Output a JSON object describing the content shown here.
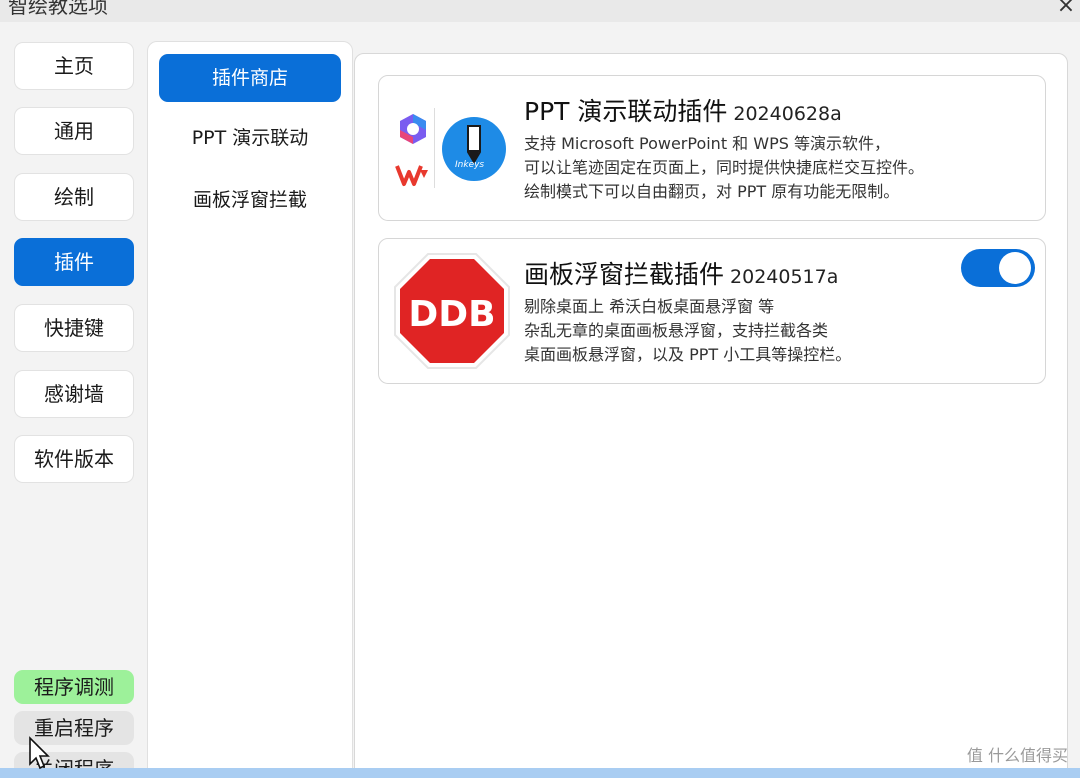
{
  "window": {
    "title": "智绘教选项",
    "close_glyph": "×"
  },
  "nav": {
    "items": [
      {
        "label": "主页",
        "active": false
      },
      {
        "label": "通用",
        "active": false
      },
      {
        "label": "绘制",
        "active": false
      },
      {
        "label": "插件",
        "active": true
      },
      {
        "label": "快捷键",
        "active": false
      },
      {
        "label": "感谢墙",
        "active": false
      },
      {
        "label": "软件版本",
        "active": false
      }
    ],
    "debug_label": "程序调测",
    "restart_label": "重启程序",
    "close_label": "关闭程序"
  },
  "subnav": {
    "items": [
      {
        "label": "插件商店",
        "active": true
      },
      {
        "label": "PPT 演示联动",
        "active": false
      },
      {
        "label": "画板浮窗拦截",
        "active": false
      }
    ]
  },
  "plugins": [
    {
      "title": "PPT 演示联动插件",
      "version": "20240628a",
      "desc": [
        "支持 Microsoft PowerPoint 和 WPS 等演示软件，",
        "可以让笔迹固定在页面上，同时提供快捷底栏交互控件。",
        "绘制模式下可以自由翻页，对 PPT 原有功能无限制。"
      ],
      "icon_label": "Inkeys",
      "toggle": null
    },
    {
      "title": "画板浮窗拦截插件",
      "version": "20240517a",
      "desc": [
        "剔除桌面上 希沃白板桌面悬浮窗 等",
        "杂乱无章的桌面画板悬浮窗，支持拦截各类",
        "桌面画板悬浮窗，以及 PPT 小工具等操控栏。"
      ],
      "icon_label": "DDB",
      "toggle": true
    }
  ],
  "watermark": "值 什么值得买",
  "colors": {
    "accent": "#0a6fd8",
    "debug": "#9df19a",
    "stop_red": "#e02424"
  }
}
